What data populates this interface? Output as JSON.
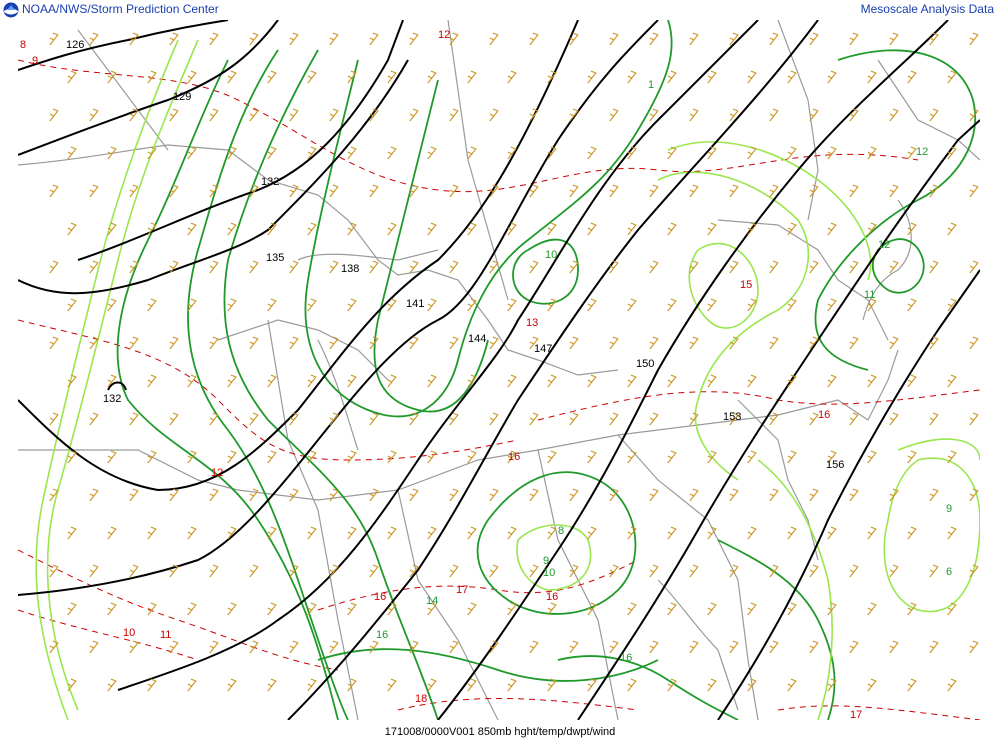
{
  "header": {
    "source": "NOAA/NWS/Storm Prediction Center",
    "product": "Mesoscale Analysis Data"
  },
  "footer": {
    "caption": "171008/0000V001 850mb hght/temp/dwpt/wind"
  },
  "colors": {
    "height": "#000000",
    "temperature": "#cc0000",
    "dewpoint_dark": "#1f9a2a",
    "dewpoint_light": "#99e64d",
    "border": "#9a9a9a",
    "wind": "#c89623",
    "header_text": "#1a3fb0"
  },
  "icons": {
    "logo": "noaa-logo-icon"
  },
  "labels": {
    "height": [
      "126",
      "129",
      "132",
      "135",
      "138",
      "141",
      "144",
      "147",
      "150",
      "153",
      "156",
      "132"
    ],
    "temperature": [
      "8",
      "9",
      "10",
      "11",
      "12",
      "12",
      "13",
      "15",
      "16",
      "16",
      "16",
      "16",
      "17",
      "17",
      "18"
    ],
    "dewpoint": [
      "1",
      "12",
      "12",
      "11",
      "10",
      "8",
      "9",
      "10",
      "14",
      "16",
      "16",
      "9",
      "6"
    ]
  }
}
